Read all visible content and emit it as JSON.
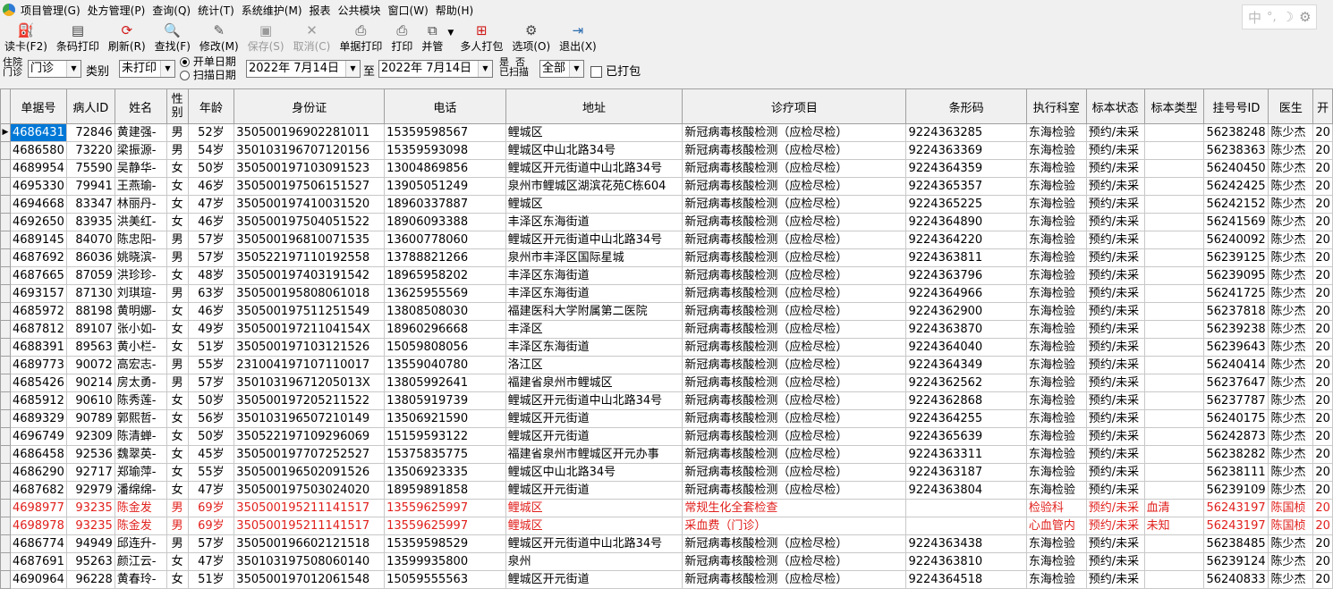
{
  "menu": [
    "项目管理(G)",
    "处方管理(P)",
    "查询(Q)",
    "统计(T)",
    "系统维护(M)",
    "报表",
    "公共模块",
    "窗口(W)",
    "帮助(H)"
  ],
  "ime": {
    "label": "中",
    "dot": "°,",
    "moon": "☽",
    "gear": "⚙"
  },
  "toolbar": [
    {
      "label": "读卡(F2)",
      "icon": "card-reader-icon",
      "glyph": "⛽",
      "color": "#3a5fcd",
      "disabled": false
    },
    {
      "label": "条码打印",
      "icon": "barcode-printer-icon",
      "glyph": "▤",
      "color": "#444444",
      "disabled": false
    },
    {
      "label": "刷新(R)",
      "icon": "refresh-icon",
      "glyph": "⟳",
      "color": "#d01818",
      "disabled": false
    },
    {
      "label": "查找(F)",
      "icon": "search-icon",
      "glyph": "🔍",
      "color": "#2a6db0",
      "disabled": false
    },
    {
      "label": "修改(M)",
      "icon": "edit-icon",
      "glyph": "✎",
      "color": "#555555",
      "disabled": false
    },
    {
      "label": "保存(S)",
      "icon": "save-icon",
      "glyph": "▣",
      "color": "#9a9a9a",
      "disabled": true
    },
    {
      "label": "取消(C)",
      "icon": "cancel-icon",
      "glyph": "✕",
      "color": "#9a9a9a",
      "disabled": true
    },
    {
      "label": "单据打印",
      "icon": "printer-icon",
      "glyph": "⎙",
      "color": "#444444",
      "disabled": false
    },
    {
      "label": "打印",
      "icon": "printer-icon",
      "glyph": "⎙",
      "color": "#444444",
      "disabled": false
    },
    {
      "label": "并管",
      "icon": "merge-tube-icon",
      "glyph": "⧉",
      "color": "#444444",
      "disabled": false,
      "dropdown": true
    },
    {
      "label": "多人打包",
      "icon": "package-icon",
      "glyph": "⊞",
      "color": "#d01818",
      "disabled": false
    },
    {
      "label": "选项(O)",
      "icon": "gear-icon",
      "glyph": "⚙",
      "color": "#444444",
      "disabled": false
    },
    {
      "label": "退出(X)",
      "icon": "exit-icon",
      "glyph": "⇥",
      "color": "#2a6db0",
      "disabled": false
    }
  ],
  "filter": {
    "source_label_top": "住院",
    "source_label_bottom": "门诊",
    "source_value": "门诊",
    "category_label": "类别",
    "category_value": "未打印",
    "radio_open_date": "开单日期",
    "radio_scan_date": "扫描日期",
    "date_from": "2022年 7月14日",
    "to_label": "至",
    "date_to": "2022年 7月14日",
    "scanned_label_top": "是",
    "scanned_label_mid": "否",
    "scanned_label_bottom": "已扫描",
    "scanned_value": "全部",
    "packed_label": "已打包"
  },
  "columns": [
    "单据号",
    "病人ID",
    "姓名",
    "性别",
    "年龄",
    "身份证",
    "电话",
    "地址",
    "诊疗项目",
    "条形码",
    "执行科室",
    "标本状态",
    "标本类型",
    "挂号号ID",
    "医生",
    "开"
  ],
  "rows": [
    [
      "4686431",
      "72846",
      "黄建强-",
      "男",
      "52岁",
      "350500196902281011",
      "15359598567",
      "鲤城区",
      "新冠病毒核酸检测（应检尽检）",
      "9224363285",
      "东海检验",
      "预约/未采",
      "",
      "56238248",
      "陈少杰",
      "20"
    ],
    [
      "4686580",
      "73220",
      "梁振源-",
      "男",
      "54岁",
      "350103196707120156",
      "15359593098",
      "鲤城区中山北路34号",
      "新冠病毒核酸检测（应检尽检）",
      "9224363369",
      "东海检验",
      "预约/未采",
      "",
      "56238363",
      "陈少杰",
      "20"
    ],
    [
      "4689954",
      "75590",
      "吴静华-",
      "女",
      "50岁",
      "350500197103091523",
      "13004869856",
      "鲤城区开元街道中山北路34号",
      "新冠病毒核酸检测（应检尽检）",
      "9224364359",
      "东海检验",
      "预约/未采",
      "",
      "56240450",
      "陈少杰",
      "20"
    ],
    [
      "4695330",
      "79941",
      "王燕瑜-",
      "女",
      "46岁",
      "350500197506151527",
      "13905051249",
      "泉州市鲤城区湖滨花苑C栋604",
      "新冠病毒核酸检测（应检尽检）",
      "9224365357",
      "东海检验",
      "预约/未采",
      "",
      "56242425",
      "陈少杰",
      "20"
    ],
    [
      "4694668",
      "83347",
      "林丽丹-",
      "女",
      "47岁",
      "350500197410031520",
      "18960337887",
      "鲤城区",
      "新冠病毒核酸检测（应检尽检）",
      "9224365225",
      "东海检验",
      "预约/未采",
      "",
      "56242152",
      "陈少杰",
      "20"
    ],
    [
      "4692650",
      "83935",
      "洪美红-",
      "女",
      "46岁",
      "350500197504051522",
      "18906093388",
      "丰泽区东海街道",
      "新冠病毒核酸检测（应检尽检）",
      "9224364890",
      "东海检验",
      "预约/未采",
      "",
      "56241569",
      "陈少杰",
      "20"
    ],
    [
      "4689145",
      "84070",
      "陈忠阳-",
      "男",
      "57岁",
      "350500196810071535",
      "13600778060",
      "鲤城区开元街道中山北路34号",
      "新冠病毒核酸检测（应检尽检）",
      "9224364220",
      "东海检验",
      "预约/未采",
      "",
      "56240092",
      "陈少杰",
      "20"
    ],
    [
      "4687692",
      "86036",
      "姚晓滨-",
      "男",
      "57岁",
      "350522197110192558",
      "13788821266",
      "泉州市丰泽区国际星城",
      "新冠病毒核酸检测（应检尽检）",
      "9224363811",
      "东海检验",
      "预约/未采",
      "",
      "56239125",
      "陈少杰",
      "20"
    ],
    [
      "4687665",
      "87059",
      "洪珍珍-",
      "女",
      "48岁",
      "350500197403191542",
      "18965958202",
      "丰泽区东海街道",
      "新冠病毒核酸检测（应检尽检）",
      "9224363796",
      "东海检验",
      "预约/未采",
      "",
      "56239095",
      "陈少杰",
      "20"
    ],
    [
      "4693157",
      "87130",
      "刘琪瑄-",
      "男",
      "63岁",
      "350500195808061018",
      "13625955569",
      "丰泽区东海街道",
      "新冠病毒核酸检测（应检尽检）",
      "9224364966",
      "东海检验",
      "预约/未采",
      "",
      "56241725",
      "陈少杰",
      "20"
    ],
    [
      "4685972",
      "88198",
      "黄明娜-",
      "女",
      "46岁",
      "350500197511251549",
      "13808508030",
      "福建医科大学附属第二医院",
      "新冠病毒核酸检测（应检尽检）",
      "9224362900",
      "东海检验",
      "预约/未采",
      "",
      "56237818",
      "陈少杰",
      "20"
    ],
    [
      "4687812",
      "89107",
      "张小如-",
      "女",
      "49岁",
      "35050019721104154X",
      "18960296668",
      "丰泽区",
      "新冠病毒核酸检测（应检尽检）",
      "9224363870",
      "东海检验",
      "预约/未采",
      "",
      "56239238",
      "陈少杰",
      "20"
    ],
    [
      "4688391",
      "89563",
      "黄小栏-",
      "女",
      "51岁",
      "350500197103121526",
      "15059808056",
      "丰泽区东海街道",
      "新冠病毒核酸检测（应检尽检）",
      "9224364040",
      "东海检验",
      "预约/未采",
      "",
      "56239643",
      "陈少杰",
      "20"
    ],
    [
      "4689773",
      "90072",
      "高宏志-",
      "男",
      "55岁",
      "231004197107110017",
      "13559040780",
      "洛江区",
      "新冠病毒核酸检测（应检尽检）",
      "9224364349",
      "东海检验",
      "预约/未采",
      "",
      "56240414",
      "陈少杰",
      "20"
    ],
    [
      "4685426",
      "90214",
      "房太勇-",
      "男",
      "57岁",
      "35010319671205013X",
      "13805992641",
      "福建省泉州市鲤城区",
      "新冠病毒核酸检测（应检尽检）",
      "9224362562",
      "东海检验",
      "预约/未采",
      "",
      "56237647",
      "陈少杰",
      "20"
    ],
    [
      "4685912",
      "90610",
      "陈秀莲-",
      "女",
      "50岁",
      "350500197205211522",
      "13805919739",
      "鲤城区开元街道中山北路34号",
      "新冠病毒核酸检测（应检尽检）",
      "9224362868",
      "东海检验",
      "预约/未采",
      "",
      "56237787",
      "陈少杰",
      "20"
    ],
    [
      "4689329",
      "90789",
      "郭熙哲-",
      "女",
      "56岁",
      "350103196507210149",
      "13506921590",
      "鲤城区开元街道",
      "新冠病毒核酸检测（应检尽检）",
      "9224364255",
      "东海检验",
      "预约/未采",
      "",
      "56240175",
      "陈少杰",
      "20"
    ],
    [
      "4696749",
      "92309",
      "陈清蝉-",
      "女",
      "50岁",
      "350522197109296069",
      "15159593122",
      "鲤城区开元街道",
      "新冠病毒核酸检测（应检尽检）",
      "9224365639",
      "东海检验",
      "预约/未采",
      "",
      "56242873",
      "陈少杰",
      "20"
    ],
    [
      "4686458",
      "92536",
      "魏翠英-",
      "女",
      "45岁",
      "350500197707252527",
      "15375835775",
      "福建省泉州市鲤城区开元办事",
      "新冠病毒核酸检测（应检尽检）",
      "9224363311",
      "东海检验",
      "预约/未采",
      "",
      "56238282",
      "陈少杰",
      "20"
    ],
    [
      "4686290",
      "92717",
      "郑瑜萍-",
      "女",
      "55岁",
      "350500196502091526",
      "13506923335",
      "鲤城区中山北路34号",
      "新冠病毒核酸检测（应检尽检）",
      "9224363187",
      "东海检验",
      "预约/未采",
      "",
      "56238111",
      "陈少杰",
      "20"
    ],
    [
      "4687682",
      "92979",
      "潘绵绵-",
      "女",
      "47岁",
      "350500197503024020",
      "18959891858",
      "鲤城区开元街道",
      "新冠病毒核酸检测（应检尽检）",
      "9224363804",
      "东海检验",
      "预约/未采",
      "",
      "56239109",
      "陈少杰",
      "20"
    ],
    [
      "4698977",
      "93235",
      "陈金发",
      "男",
      "69岁",
      "350500195211141517",
      "13559625997",
      "鲤城区",
      "常规生化全套检查",
      "",
      "检验科",
      "预约/未采",
      "血清",
      "56243197",
      "陈国桢",
      "20"
    ],
    [
      "4698978",
      "93235",
      "陈金发",
      "男",
      "69岁",
      "350500195211141517",
      "13559625997",
      "鲤城区",
      "采血费（门诊）",
      "",
      "心血管内",
      "预约/未采",
      "未知",
      "56243197",
      "陈国桢",
      "20"
    ],
    [
      "4686774",
      "94949",
      "邱连升-",
      "男",
      "57岁",
      "350500196602121518",
      "15359598529",
      "鲤城区开元街道中山北路34号",
      "新冠病毒核酸检测（应检尽检）",
      "9224363438",
      "东海检验",
      "预约/未采",
      "",
      "56238485",
      "陈少杰",
      "20"
    ],
    [
      "4687691",
      "95263",
      "颜江云-",
      "女",
      "47岁",
      "350103197508060140",
      "13599935800",
      "泉州",
      "新冠病毒核酸检测（应检尽检）",
      "9224363810",
      "东海检验",
      "预约/未采",
      "",
      "56239124",
      "陈少杰",
      "20"
    ],
    [
      "4690964",
      "96228",
      "黄春玲-",
      "女",
      "51岁",
      "350500197012061548",
      "15059555563",
      "鲤城区开元街道",
      "新冠病毒核酸检测（应检尽检）",
      "9224364518",
      "东海检验",
      "预约/未采",
      "",
      "56240833",
      "陈少杰",
      "20"
    ]
  ],
  "highlighted_rows": [
    21,
    22
  ],
  "selected_row": 0
}
